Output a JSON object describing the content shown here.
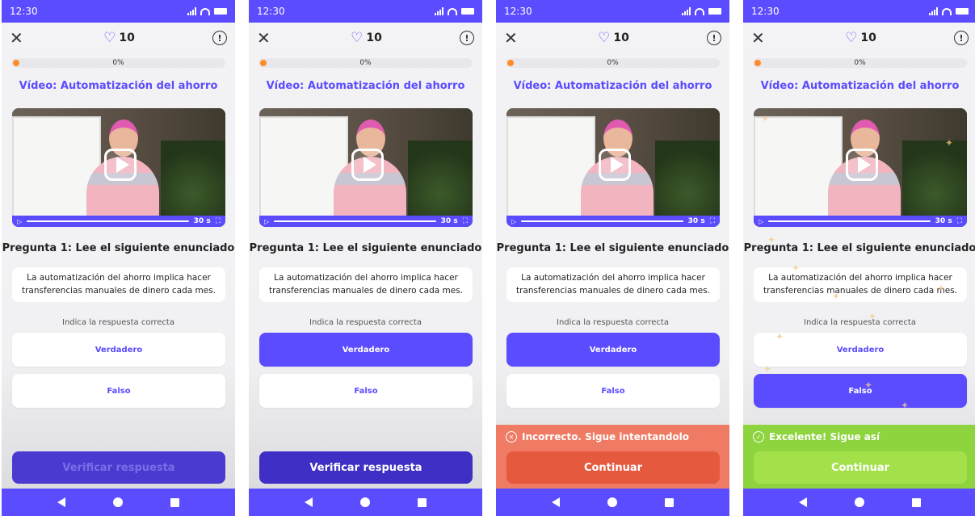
{
  "status": {
    "time": "12:30"
  },
  "header": {
    "lives": "10"
  },
  "progress": {
    "label": "0%",
    "value": 0
  },
  "lesson_title": "Vídeo: Automatización del ahorro",
  "video": {
    "duration": "30 s"
  },
  "question": {
    "title": "Pregunta 1: Lee el siguiente enunciado",
    "statement": "La automatización del ahorro implica hacer transferencias manuales de dinero cada mes.",
    "hint": "Indica la respuesta correcta"
  },
  "options": {
    "true_label": "Verdadero",
    "false_label": "Falso"
  },
  "verify_label": "Verificar respuesta",
  "feedback": {
    "wrong": "Incorrecto. Sigue intentandolo",
    "right": "Excelente! Sigue así",
    "continue_label": "Continuar"
  },
  "colors": {
    "brand": "#5b4cff",
    "progress_dot": "#ff8a2a",
    "wrong_bg": "#ef7b64",
    "wrong_button": "#e55a3f",
    "right_bg": "#8dd43e",
    "right_button": "#a3e04a"
  },
  "icons": [
    "close-icon",
    "heart-icon",
    "info-icon",
    "play-icon",
    "fullscreen-icon",
    "close-circle-icon",
    "check-circle-icon",
    "back-icon",
    "home-icon",
    "recents-icon"
  ]
}
